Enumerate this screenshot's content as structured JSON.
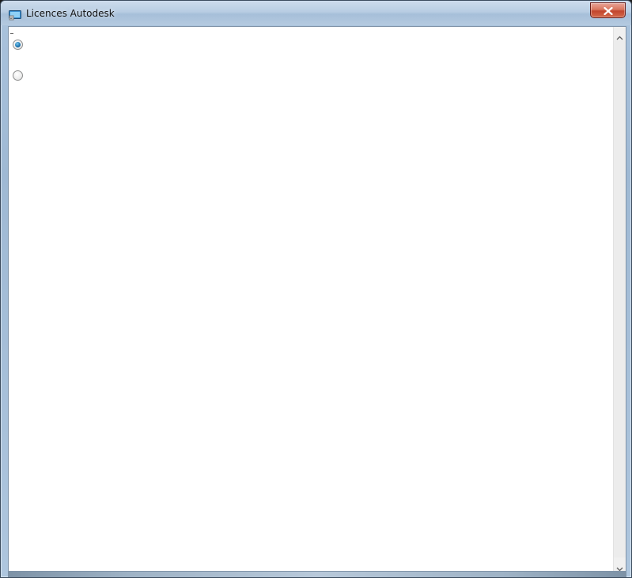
{
  "window": {
    "title": "Licences Autodesk",
    "close_label": "Close"
  },
  "options": [
    {
      "label": "",
      "checked": true
    },
    {
      "label": "",
      "checked": false
    }
  ],
  "colors": {
    "titlebar": "#b8cde3",
    "close_button": "#c2452d",
    "radio_selected": "#1d78b3",
    "client_background": "#ffffff"
  },
  "icons": {
    "app": "autodesk-license-icon",
    "close": "close-x-icon",
    "scroll_up": "chevron-up-icon",
    "scroll_down": "chevron-down-icon"
  }
}
